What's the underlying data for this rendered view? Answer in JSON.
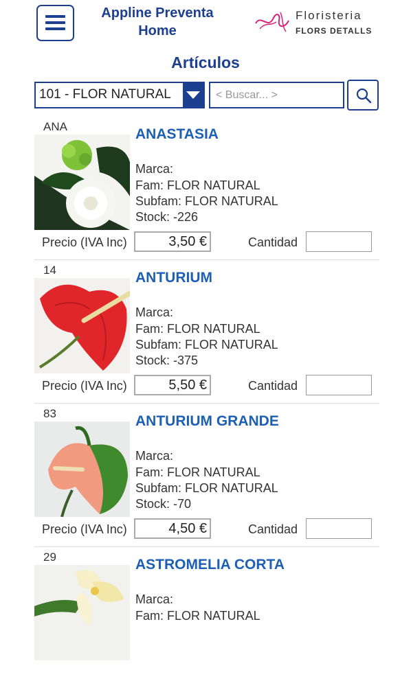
{
  "header": {
    "title_line1": "Appline Preventa",
    "title_line2": "Home",
    "logo_line1": "Floristeria",
    "logo_line2": "FLORS DETALLS"
  },
  "section_title": "Artículos",
  "filter": {
    "family_selected": "101 - FLOR NATURAL",
    "search_placeholder": "< Buscar... >"
  },
  "labels": {
    "price": "Precio (IVA Inc)",
    "quantity": "Cantidad"
  },
  "products": [
    {
      "code": "ANA",
      "name": "ANASTASIA",
      "marca": "Marca:",
      "fam": "Fam: FLOR NATURAL",
      "subfam": "Subfam: FLOR NATURAL",
      "stock": "Stock: -226",
      "price": "3,50 €"
    },
    {
      "code": "14",
      "name": "ANTURIUM",
      "marca": "Marca:",
      "fam": "Fam: FLOR NATURAL",
      "subfam": "Subfam: FLOR NATURAL",
      "stock": "Stock: -375",
      "price": "5,50 €"
    },
    {
      "code": "83",
      "name": "ANTURIUM GRANDE",
      "marca": "Marca:",
      "fam": "Fam: FLOR NATURAL",
      "subfam": "Subfam: FLOR NATURAL",
      "stock": "Stock: -70",
      "price": "4,50 €"
    },
    {
      "code": "29",
      "name": "ASTROMELIA CORTA",
      "marca": "Marca:",
      "fam": "Fam: FLOR NATURAL"
    }
  ],
  "colors": {
    "primary": "#1d3f8f",
    "product_name": "#1d5fb4",
    "logo_accent": "#d6247a"
  }
}
